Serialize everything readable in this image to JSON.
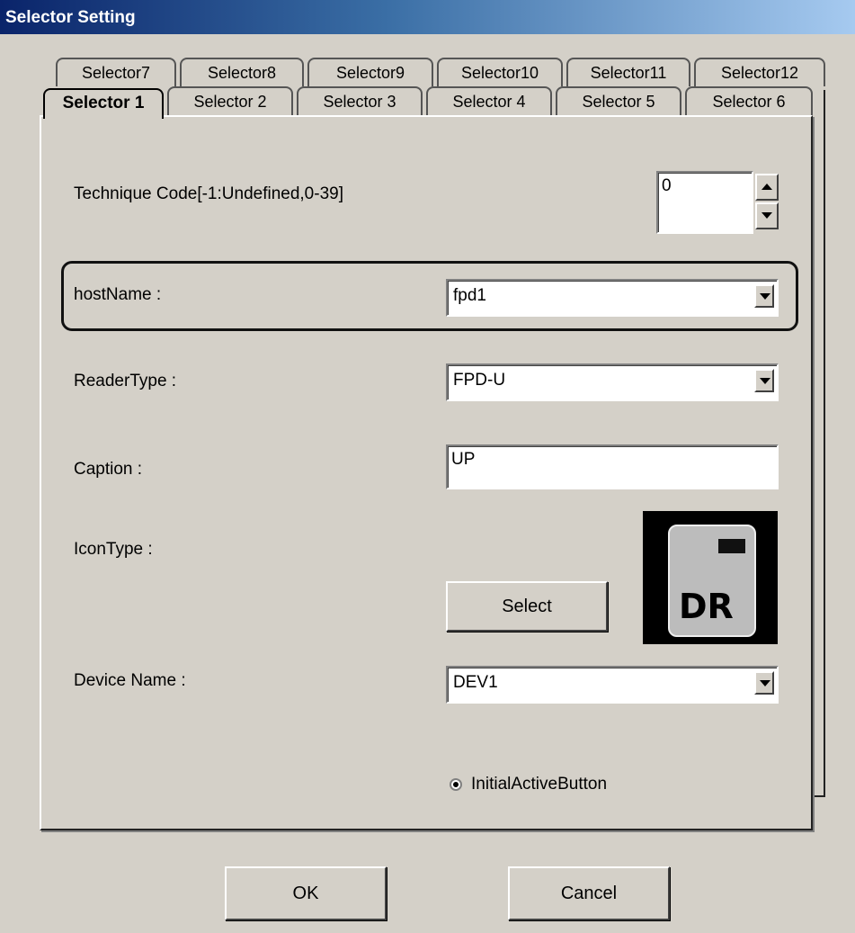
{
  "window": {
    "title": "Selector Setting"
  },
  "tabs": {
    "row1": [
      "Selector7",
      "Selector8",
      "Selector9",
      "Selector10",
      "Selector11",
      "Selector12"
    ],
    "row2": [
      "Selector 1",
      "Selector 2",
      "Selector 3",
      "Selector 4",
      "Selector 5",
      "Selector 6"
    ],
    "active": "Selector 1"
  },
  "form": {
    "technique_code": {
      "label": "Technique Code[-1:Undefined,0-39]",
      "value": "0"
    },
    "host_name": {
      "label": "hostName :",
      "value": "fpd1"
    },
    "reader_type": {
      "label": "ReaderType :",
      "value": "FPD-U"
    },
    "caption": {
      "label": "Caption :",
      "value": "UP"
    },
    "icon_type": {
      "label": "IconType :",
      "select_label": "Select",
      "icon_text": "DR",
      "icon_name": "dr-device-icon"
    },
    "device_name": {
      "label": "Device Name :",
      "value": "DEV1"
    },
    "initial_active": {
      "label": "InitialActiveButton",
      "checked": true
    }
  },
  "buttons": {
    "ok": "OK",
    "cancel": "Cancel"
  }
}
